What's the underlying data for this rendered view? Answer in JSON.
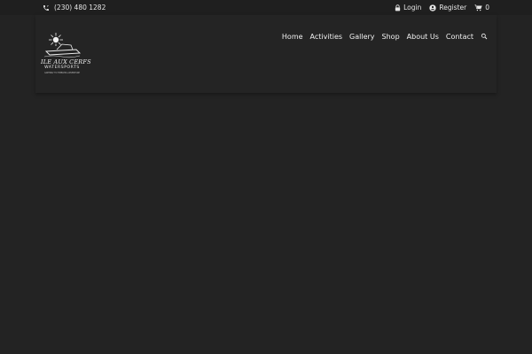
{
  "topbar": {
    "phone": "(230) 480 1282",
    "phone_icon": "phone-icon",
    "login_label": "Login",
    "login_icon": "lock-icon",
    "register_label": "Register",
    "register_icon": "account-circle-icon",
    "cart_count": "0",
    "cart_icon": "cart-icon"
  },
  "logo": {
    "brand": "ILE AUX CERFS",
    "subtitle": "WATERSPORTS",
    "tagline": "GATEWAY TO TIMELESS ADVENTURE"
  },
  "nav": {
    "items": [
      "Home",
      "Activities",
      "Gallery",
      "Shop",
      "About Us",
      "Contact"
    ],
    "search_icon": "search-icon"
  },
  "colors": {
    "background": "#232323",
    "topbar": "#1f1f1f",
    "header": "#242424",
    "text": "#e6e6e6"
  }
}
